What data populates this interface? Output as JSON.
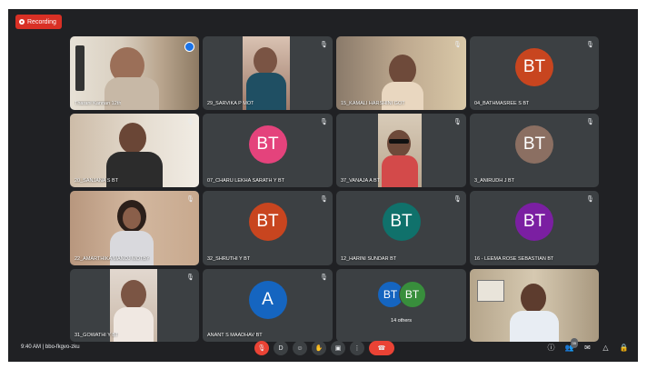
{
  "recording_label": "Recording",
  "colors": {
    "avatar_orange": "#c8451f",
    "avatar_pink": "#e4437c",
    "avatar_taupe": "#8b6f62",
    "avatar_teal": "#10716b",
    "avatar_purple": "#7b1fa2",
    "avatar_blue": "#1565c0",
    "avatar_green": "#388e3c",
    "recording_red": "#d93025",
    "end_call_red": "#ea4335"
  },
  "participants": [
    {
      "name": "Tharani Kannan 12th",
      "kind": "video",
      "pinned": true
    },
    {
      "name": "29_SARVIKA P MOT",
      "kind": "video"
    },
    {
      "name": "15_KAMALI HARSHINI GOT",
      "kind": "video"
    },
    {
      "name": "04_BATHMASREE S BT",
      "kind": "avatar",
      "initials": "BT",
      "color": "avatar_orange"
    },
    {
      "name": "20_SANJANA S BT",
      "kind": "video"
    },
    {
      "name": "07_CHARU LEKHA SARATH Y BT",
      "kind": "avatar",
      "initials": "BT",
      "color": "avatar_pink"
    },
    {
      "name": "37_VANAJA A BT",
      "kind": "video"
    },
    {
      "name": "3_ANIRUDH J BT",
      "kind": "avatar",
      "initials": "BT",
      "color": "avatar_taupe"
    },
    {
      "name": "22_AMARTHIKA MANOJ MOTBY",
      "kind": "video"
    },
    {
      "name": "32_SHRUTHI Y BT",
      "kind": "avatar",
      "initials": "BT",
      "color": "avatar_orange"
    },
    {
      "name": "12_HARINI SUNDAR BT",
      "kind": "avatar",
      "initials": "BT",
      "color": "avatar_teal"
    },
    {
      "name": "16 - LEEMA ROSE SEBASTIAN BT",
      "kind": "avatar",
      "initials": "BT",
      "color": "avatar_purple"
    },
    {
      "name": "31_GOWATHI Y BT",
      "kind": "video"
    },
    {
      "name": "ANANT S MAADHAV BT",
      "kind": "avatar",
      "initials": "A",
      "color": "avatar_blue"
    },
    {
      "name": "",
      "kind": "others",
      "label": "14 others",
      "initials": [
        "BT",
        "BT"
      ]
    },
    {
      "name": "",
      "kind": "video"
    }
  ],
  "bottom": {
    "clock": "9:40 AM | bbo-fkgvo-zku",
    "controls": [
      {
        "icon": "mic-off-icon",
        "glyph": "🎙"
      },
      {
        "icon": "captions-icon",
        "glyph": "D"
      },
      {
        "icon": "emoji-icon",
        "glyph": "☺"
      },
      {
        "icon": "raise-hand-icon",
        "glyph": "✋"
      },
      {
        "icon": "present-icon",
        "glyph": "▣"
      },
      {
        "icon": "more-options-icon",
        "glyph": "⋮"
      },
      {
        "icon": "leave-call-icon",
        "glyph": "☎"
      }
    ],
    "right": [
      {
        "icon": "info-icon",
        "glyph": "ⓘ"
      },
      {
        "icon": "people-icon",
        "glyph": "👥",
        "badge": "35"
      },
      {
        "icon": "chat-icon",
        "glyph": "✉"
      },
      {
        "icon": "activities-icon",
        "glyph": "△"
      },
      {
        "icon": "host-controls-icon",
        "glyph": "🔒"
      }
    ]
  }
}
